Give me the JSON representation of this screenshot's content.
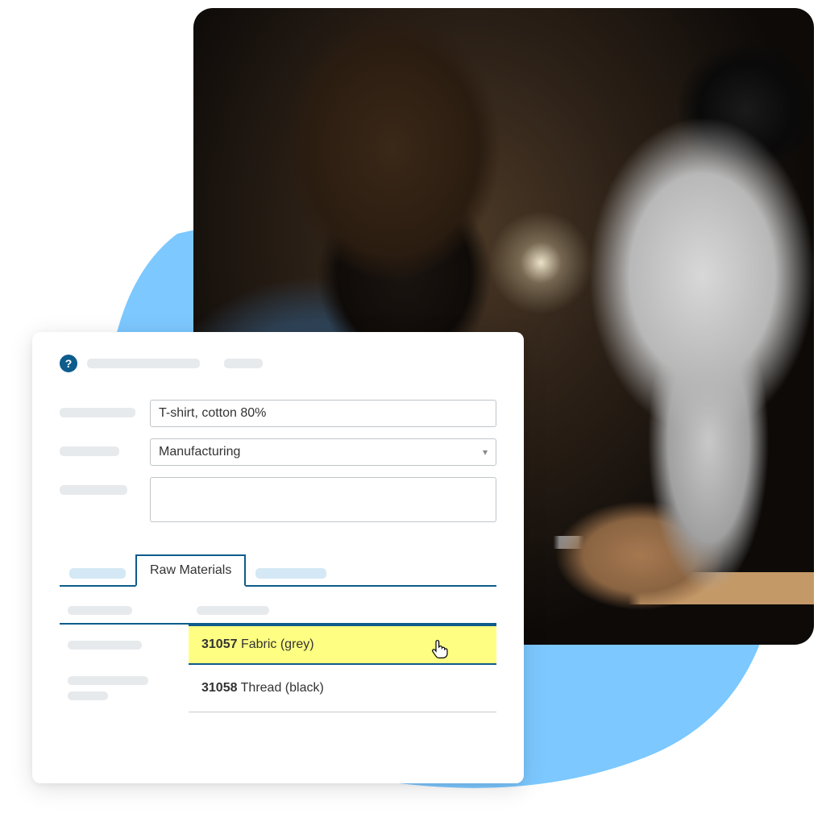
{
  "form": {
    "product_name": "T-shirt, cotton 80%",
    "category": "Manufacturing"
  },
  "tabs": {
    "active": "Raw Materials"
  },
  "materials": [
    {
      "code": "31057",
      "name": "Fabric (grey)",
      "highlighted": true
    },
    {
      "code": "31058",
      "name": "Thread (black)",
      "highlighted": false
    }
  ],
  "icons": {
    "help": "?",
    "chevron_down": "▾",
    "cursor": "👆"
  }
}
